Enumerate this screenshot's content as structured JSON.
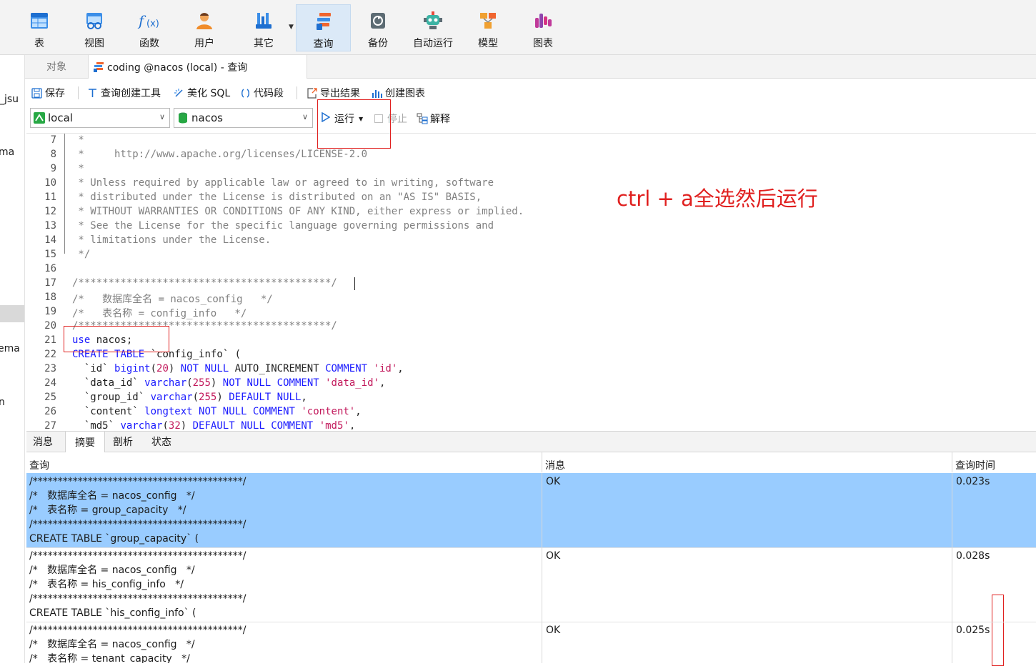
{
  "ribbon": {
    "buttons": [
      {
        "label": "表",
        "icon": "table-icon"
      },
      {
        "label": "视图",
        "icon": "view-icon"
      },
      {
        "label": "函数",
        "icon": "function-icon"
      },
      {
        "label": "用户",
        "icon": "user-icon"
      },
      {
        "label": "其它",
        "icon": "tools-icon"
      },
      {
        "label": "查询",
        "icon": "query-icon"
      },
      {
        "label": "备份",
        "icon": "backup-icon"
      },
      {
        "label": "自动运行",
        "icon": "robot-icon"
      },
      {
        "label": "模型",
        "icon": "model-icon"
      },
      {
        "label": "图表",
        "icon": "chart-icon"
      }
    ],
    "active": "查询"
  },
  "sidebar": {
    "fragments": [
      "_jsu",
      "ma",
      "ema",
      "n"
    ]
  },
  "tabs": {
    "objects": "对象",
    "query_tab": "coding @nacos (local) - 查询"
  },
  "toolbar": {
    "save": "保存",
    "query_builder": "查询创建工具",
    "beautify_sql": "美化 SQL",
    "snippet": "代码段",
    "export_results": "导出结果",
    "create_chart": "创建图表"
  },
  "connection": {
    "server": "local",
    "database": "nacos",
    "run": "运行",
    "stop": "停止",
    "explain": "解释"
  },
  "editor": {
    "annotation": "ctrl + a全选然后运行",
    "lines": [
      {
        "n": "7",
        "text": " *"
      },
      {
        "n": "8",
        "text": " *     http://www.apache.org/licenses/LICENSE-2.0"
      },
      {
        "n": "9",
        "text": " *"
      },
      {
        "n": "10",
        "text": " * Unless required by applicable law or agreed to in writing, software"
      },
      {
        "n": "11",
        "text": " * distributed under the License is distributed on an \"AS IS\" BASIS,"
      },
      {
        "n": "12",
        "text": " * WITHOUT WARRANTIES OR CONDITIONS OF ANY KIND, either express or implied."
      },
      {
        "n": "13",
        "text": " * See the License for the specific language governing permissions and"
      },
      {
        "n": "14",
        "text": " * limitations under the License."
      },
      {
        "n": "15",
        "text": " */"
      },
      {
        "n": "16",
        "text": ""
      },
      {
        "n": "17",
        "text": "/******************************************/"
      },
      {
        "n": "18",
        "text": "/*   数据库全名 = nacos_config   */"
      },
      {
        "n": "19",
        "text": "/*   表名称 = config_info   */"
      },
      {
        "n": "20",
        "text": "/******************************************/"
      },
      {
        "n": "21",
        "text": "use nacos;"
      },
      {
        "n": "22",
        "text": "CREATE TABLE `config_info` ("
      },
      {
        "n": "23",
        "text": "  `id` bigint(20) NOT NULL AUTO_INCREMENT COMMENT 'id',"
      },
      {
        "n": "24",
        "text": "  `data_id` varchar(255) NOT NULL COMMENT 'data_id',"
      },
      {
        "n": "25",
        "text": "  `group_id` varchar(255) DEFAULT NULL,"
      },
      {
        "n": "26",
        "text": "  `content` longtext NOT NULL COMMENT 'content',"
      },
      {
        "n": "27",
        "text": "  `md5` varchar(32) DEFAULT NULL COMMENT 'md5',"
      }
    ]
  },
  "results": {
    "tabs": [
      "消息",
      "摘要",
      "剖析",
      "状态"
    ],
    "active_tab": "摘要",
    "columns": [
      "查询",
      "消息",
      "查询时间"
    ],
    "rows": [
      {
        "query": "/******************************************/\n/*   数据库全名 = nacos_config   */\n/*   表名称 = group_capacity   */\n/******************************************/\nCREATE TABLE `group_capacity` (",
        "message": "OK",
        "time": "0.023s",
        "selected": true
      },
      {
        "query": "/******************************************/\n/*   数据库全名 = nacos_config   */\n/*   表名称 = his_config_info   */\n/******************************************/\nCREATE TABLE `his_config_info` (",
        "message": "OK",
        "time": "0.028s",
        "selected": false
      },
      {
        "query": "/******************************************/\n/*   数据库全名 = nacos_config   */\n/*   表名称 = tenant_capacity   */",
        "message": "OK",
        "time": "0.025s",
        "selected": false
      }
    ]
  },
  "colors": {
    "annotation_red": "#e0201f",
    "selected_row": "#99ccff",
    "keyword": "#1a1aff",
    "string": "#c2185b",
    "comment": "#808080"
  }
}
